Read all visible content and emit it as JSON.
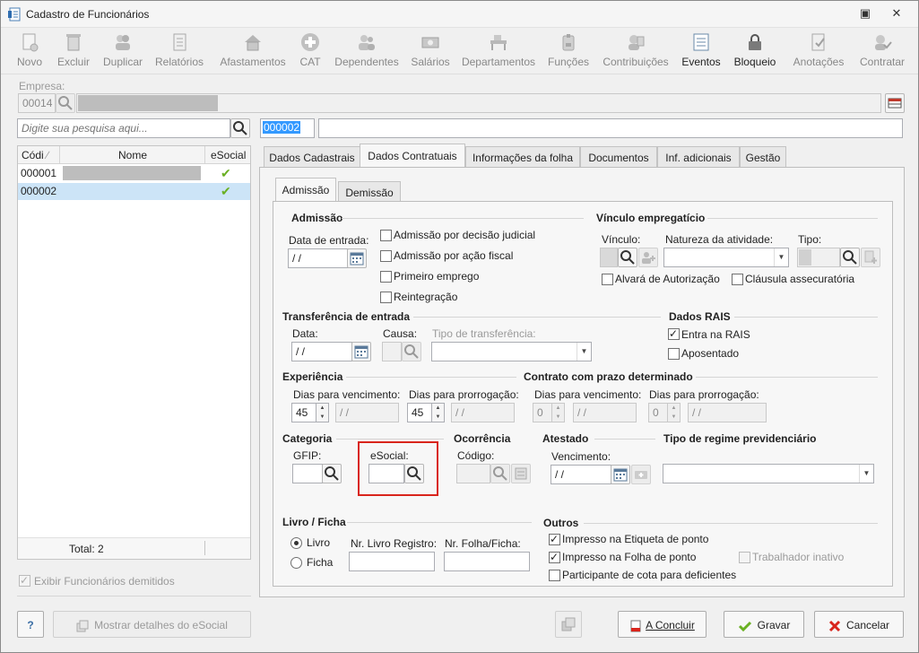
{
  "window": {
    "title": "Cadastro de Funcionários"
  },
  "toolbar": {
    "buttons": [
      {
        "label": "Novo",
        "icon": "new-document-icon",
        "enabled": false
      },
      {
        "label": "Excluir",
        "icon": "trash-icon",
        "enabled": false
      },
      {
        "label": "Duplicar",
        "icon": "duplicate-icon",
        "enabled": false
      },
      {
        "label": "Relatórios",
        "icon": "report-icon",
        "enabled": false
      },
      {
        "label": "Afastamentos",
        "icon": "house-icon",
        "enabled": false
      },
      {
        "label": "CAT",
        "icon": "medical-cross-icon",
        "enabled": false
      },
      {
        "label": "Dependentes",
        "icon": "people-icon",
        "enabled": false
      },
      {
        "label": "Salários",
        "icon": "money-icon",
        "enabled": false
      },
      {
        "label": "Departamentos",
        "icon": "desk-icon",
        "enabled": false
      },
      {
        "label": "Funções",
        "icon": "badge-icon",
        "enabled": false
      },
      {
        "label": "Contribuições",
        "icon": "contributions-icon",
        "enabled": false
      },
      {
        "label": "Eventos",
        "icon": "list-icon",
        "enabled": true
      },
      {
        "label": "Bloqueio",
        "icon": "lock-icon",
        "enabled": true
      },
      {
        "label": "Anotações",
        "icon": "notes-icon",
        "enabled": false
      },
      {
        "label": "Contratar",
        "icon": "hire-icon",
        "enabled": false
      }
    ]
  },
  "empresa": {
    "label": "Empresa:",
    "code": "00014"
  },
  "search": {
    "placeholder": "Digite sua pesquisa aqui...",
    "code": "000002"
  },
  "employee_list": {
    "columns": [
      "Códi",
      "Nome",
      "eSocial"
    ],
    "rows": [
      {
        "code": "000001",
        "esocial": "✔"
      },
      {
        "code": "000002",
        "esocial": "✔"
      }
    ],
    "total": "Total: 2"
  },
  "show_dismissed": "Exibir Funcionários demitidos",
  "tabs": [
    "Dados Cadastrais",
    "Dados Contratuais",
    "Informações da folha",
    "Documentos",
    "Inf. adicionais",
    "Gestão"
  ],
  "subtabs": [
    "Admissão",
    "Demissão"
  ],
  "admissao": {
    "title": "Admissão",
    "data_entrada_label": "Data de entrada:",
    "data_entrada_value": " /  /",
    "checks": [
      "Admissão por decisão judicial",
      "Admissão por ação fiscal",
      "Primeiro emprego",
      "Reintegração"
    ]
  },
  "vinculo": {
    "title": "Vínculo empregatício",
    "vinculo_label": "Vínculo:",
    "natureza_label": "Natureza da atividade:",
    "tipo_label": "Tipo:",
    "alvara": "Alvará de Autorização",
    "clausula": "Cláusula assecuratória"
  },
  "transferencia": {
    "title": "Transferência de entrada",
    "data_label": "Data:",
    "data_value": " /  /",
    "causa_label": "Causa:",
    "tipo_label": "Tipo de transferência:"
  },
  "rais": {
    "title": "Dados RAIS",
    "entra": "Entra na RAIS",
    "aposentado": "Aposentado"
  },
  "experiencia": {
    "title": "Experiência",
    "dias_venc_label": "Dias para vencimento:",
    "dias_venc_value": "45",
    "dias_venc_date": " /  /",
    "dias_prorr_label": "Dias para prorrogação:",
    "dias_prorr_value": "45",
    "dias_prorr_date": " /  /"
  },
  "contrato": {
    "title": "Contrato com prazo determinado",
    "dias_venc_label": "Dias para vencimento:",
    "dias_venc_value": "0",
    "dias_venc_date": " /  /",
    "dias_prorr_label": "Dias para prorrogação:",
    "dias_prorr_value": "0",
    "dias_prorr_date": " /  /"
  },
  "categoria": {
    "title": "Categoria",
    "gfip_label": "GFIP:",
    "esocial_label": "eSocial:"
  },
  "ocorrencia": {
    "title": "Ocorrência",
    "codigo_label": "Código:"
  },
  "atestado": {
    "title": "Atestado",
    "vencimento_label": "Vencimento:",
    "vencimento_value": " /  /"
  },
  "regime": {
    "title": "Tipo de regime previdenciário"
  },
  "livro": {
    "title": "Livro / Ficha",
    "livro": "Livro",
    "ficha": "Ficha",
    "nr_livro_label": "Nr. Livro Registro:",
    "nr_folha_label": "Nr. Folha/Ficha:"
  },
  "outros": {
    "title": "Outros",
    "etiqueta": "Impresso na Etiqueta de ponto",
    "folha": "Impresso na Folha de ponto",
    "inativo": "Trabalhador inativo",
    "cota": "Participante de cota para deficientes"
  },
  "footer": {
    "help": "?",
    "esocial_details": "Mostrar detalhes do eSocial",
    "concluir": "A Concluir",
    "gravar": "Gravar",
    "cancelar": "Cancelar"
  },
  "colors": {
    "highlight": "#d9251c",
    "selection": "#cce4f7",
    "check": "#6ab023",
    "cancel": "#d9251c"
  }
}
